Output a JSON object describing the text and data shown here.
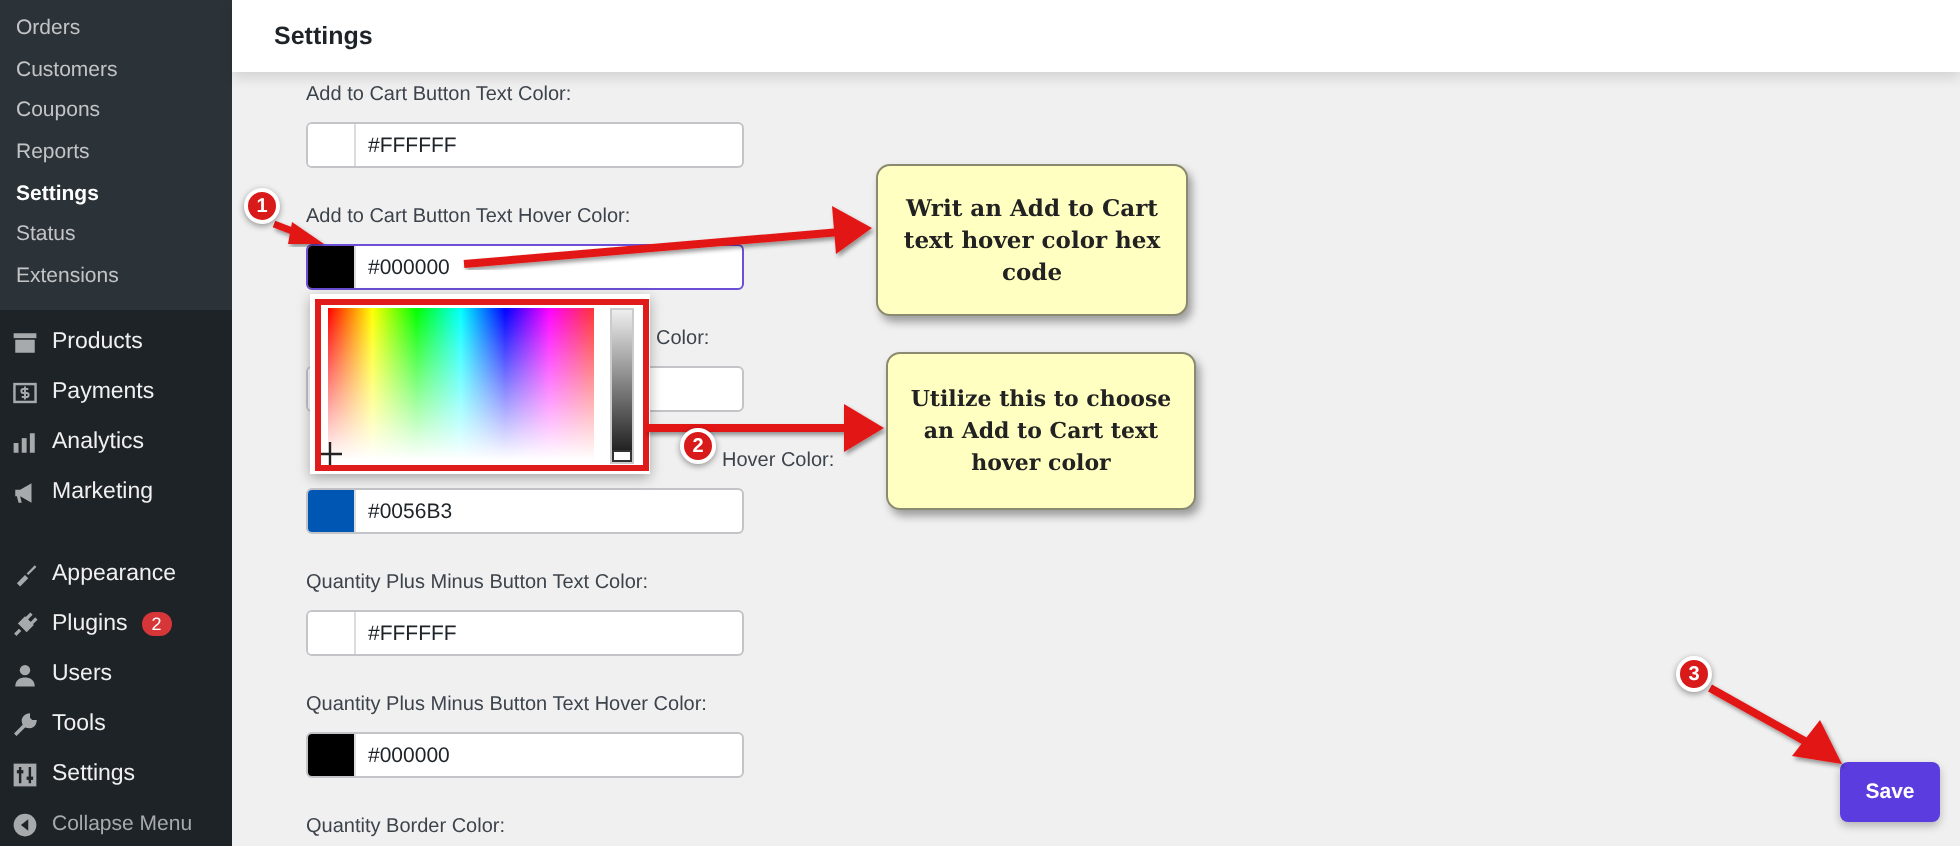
{
  "sidebar": {
    "submenu": [
      {
        "label": "Orders",
        "selected": false
      },
      {
        "label": "Customers",
        "selected": false
      },
      {
        "label": "Coupons",
        "selected": false
      },
      {
        "label": "Reports",
        "selected": false
      },
      {
        "label": "Settings",
        "selected": true
      },
      {
        "label": "Status",
        "selected": false
      },
      {
        "label": "Extensions",
        "selected": false
      }
    ],
    "menu_groups": [
      [
        {
          "label": "Products",
          "kind": "item"
        },
        {
          "label": "Payments",
          "kind": "item"
        },
        {
          "label": "Analytics",
          "kind": "item"
        },
        {
          "label": "Marketing",
          "kind": "item"
        }
      ],
      [
        {
          "label": "Appearance",
          "kind": "item"
        },
        {
          "label": "Plugins",
          "kind": "item",
          "badge": "2"
        },
        {
          "label": "Users",
          "kind": "item"
        },
        {
          "label": "Tools",
          "kind": "item"
        },
        {
          "label": "Settings",
          "kind": "item"
        },
        {
          "label": "Collapse Menu",
          "kind": "collapse"
        }
      ]
    ]
  },
  "header": {
    "title": "Settings"
  },
  "fields": [
    {
      "kind": "full",
      "label": "Add to Cart Button Text Color:",
      "value": "#FFFFFF",
      "color": "#ffffff",
      "focused": false
    },
    {
      "kind": "full",
      "label": "Add to Cart Button Text Hover Color:",
      "value": "#000000",
      "color": "#000000",
      "focused": true
    },
    {
      "kind": "partial",
      "label": "Color:",
      "focused": false
    },
    {
      "kind": "partial",
      "label": "Hover Color:",
      "value": "#0056B3",
      "color": "#0056b3",
      "focused": false
    },
    {
      "kind": "full",
      "label": "Quantity Plus Minus Button Text Color:",
      "value": "#FFFFFF",
      "color": "#ffffff",
      "focused": false
    },
    {
      "kind": "full",
      "label": "Quantity Plus Minus Button Text Hover Color:",
      "value": "#000000",
      "color": "#000000",
      "focused": false
    },
    {
      "kind": "label",
      "label": "Quantity Border Color:"
    }
  ],
  "picker": {
    "level": 0
  },
  "annotations": {
    "badges": [
      "1",
      "2",
      "3"
    ],
    "callouts": [
      "Writ an Add to Cart text hover color hex code",
      "Utilize this to choose an Add to Cart text hover color"
    ]
  },
  "save_button": "Save"
}
